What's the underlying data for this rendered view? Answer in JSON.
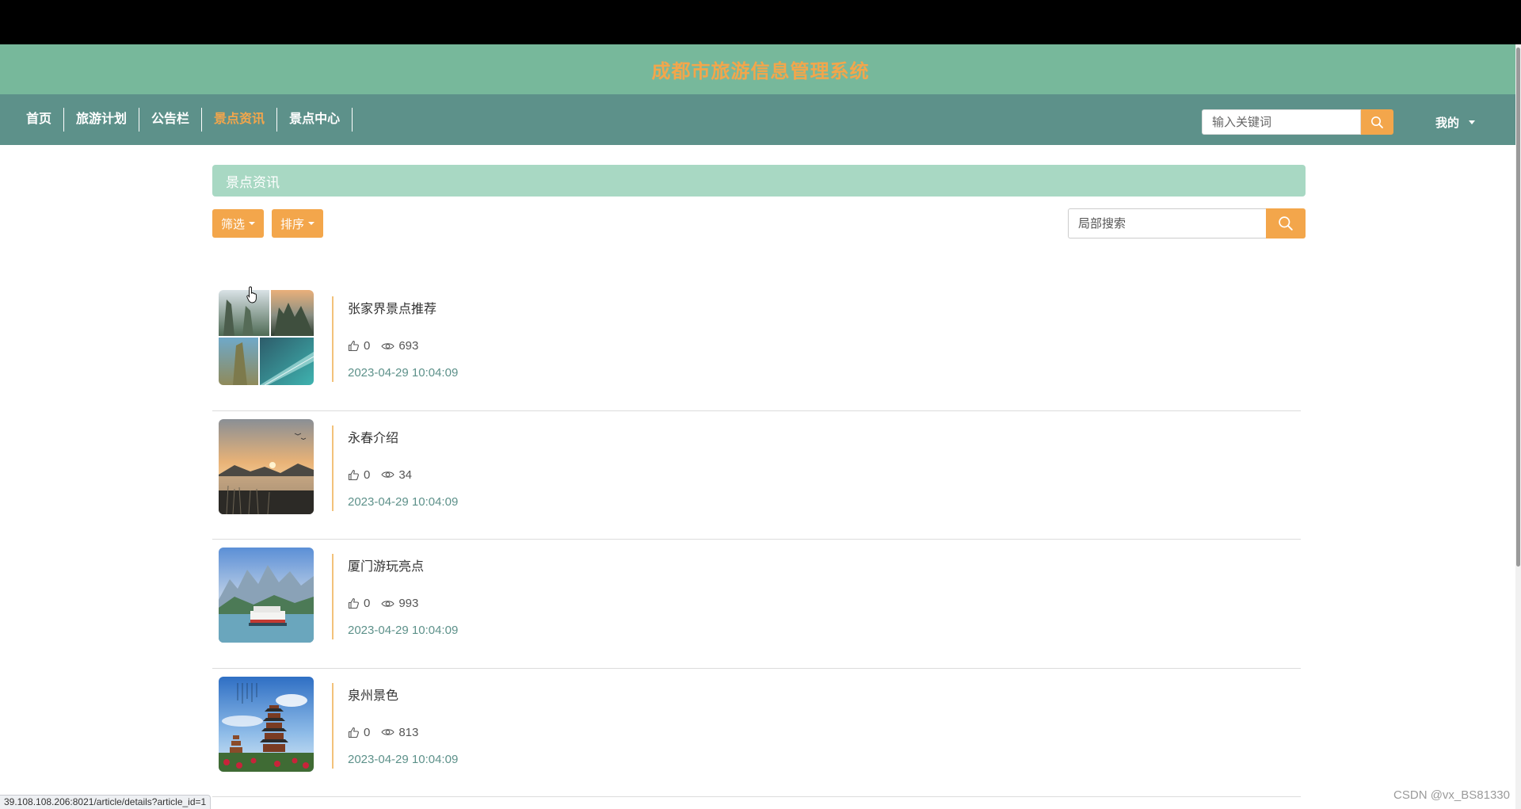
{
  "header": {
    "site_title": "成都市旅游信息管理系统"
  },
  "nav": {
    "items": [
      {
        "label": "首页",
        "active": false
      },
      {
        "label": "旅游计划",
        "active": false
      },
      {
        "label": "公告栏",
        "active": false
      },
      {
        "label": "景点资讯",
        "active": true
      },
      {
        "label": "景点中心",
        "active": false
      }
    ],
    "search_placeholder": "输入关键词",
    "search_icon": "search-icon",
    "user_menu_label": "我的",
    "active_color": "#f3a64b"
  },
  "section": {
    "title": "景点资讯",
    "filter_label": "筛选",
    "sort_label": "排序",
    "local_search_placeholder": "局部搜索"
  },
  "articles": [
    {
      "title": "张家界景点推荐",
      "likes": "0",
      "views": "693",
      "date": "2023-04-29 10:04:09",
      "thumb": "zhangjiajie-collage"
    },
    {
      "title": "永春介绍",
      "likes": "0",
      "views": "34",
      "date": "2023-04-29 10:04:09",
      "thumb": "sunset-lake"
    },
    {
      "title": "厦门游玩亮点",
      "likes": "0",
      "views": "993",
      "date": "2023-04-29 10:04:09",
      "thumb": "ferry-mountains"
    },
    {
      "title": "泉州景色",
      "likes": "0",
      "views": "813",
      "date": "2023-04-29 10:04:09",
      "thumb": "pagoda"
    }
  ],
  "status_bar": {
    "url": "39.108.108.206:8021/article/details?article_id=1"
  },
  "watermark": "CSDN @vx_BS81330",
  "colors": {
    "title_band": "#77b89b",
    "navbar": "#5d918a",
    "accent": "#f3a64b",
    "section_header": "#a8d8c3",
    "date": "#5d918a"
  }
}
